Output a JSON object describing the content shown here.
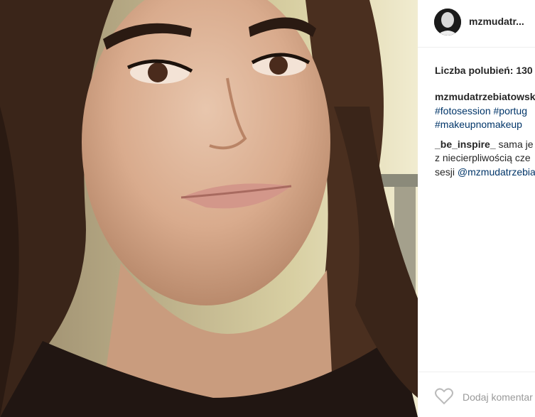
{
  "post": {
    "image_alt": "selfie"
  },
  "header": {
    "username": "mzmudatr..."
  },
  "likes": {
    "text": "Liczba polubień: 130"
  },
  "caption": {
    "author": "mzmudatrzebiatowsk",
    "tags_line1": "#fotosession #portug",
    "tags_line2": "#makeupnomakeup",
    "comment_user": "_be_inspire_",
    "comment_text_1": " sama je",
    "comment_text_2": "z niecierpliwością cze",
    "comment_text_3_prefix": "sesji ",
    "comment_mention": "@mzmudatrzebia"
  },
  "comment_box": {
    "placeholder": "Dodaj komentar"
  },
  "colors": {
    "link": "#003569",
    "text": "#262626",
    "muted": "#999999"
  }
}
